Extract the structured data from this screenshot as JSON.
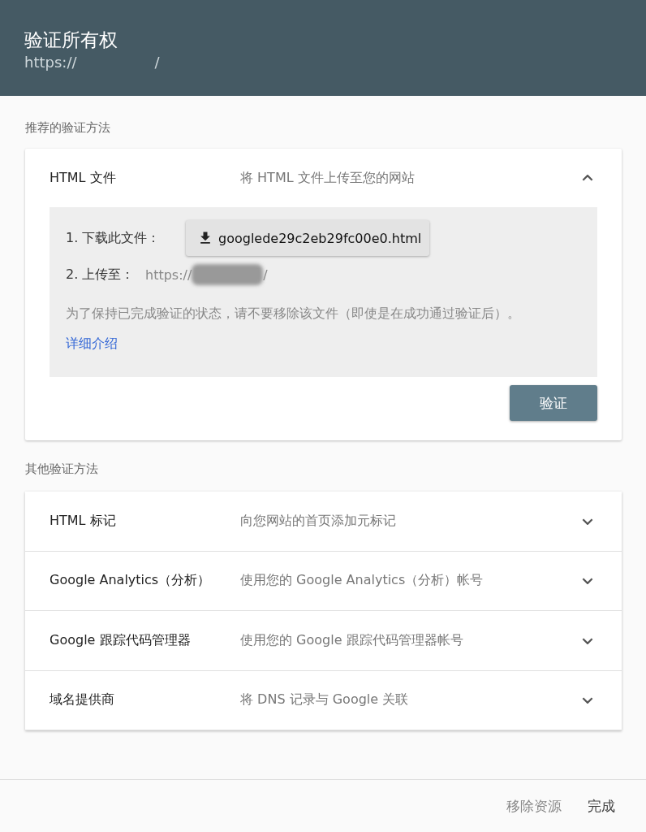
{
  "dialog": {
    "title": "验证所有权",
    "url_prefix": "https://",
    "url_suffix": "/"
  },
  "recommended": {
    "heading": "推荐的验证方法",
    "method": {
      "name": "HTML 文件",
      "description": "将 HTML 文件上传至您的网站",
      "expanded": true
    },
    "steps": {
      "download_label": "1. 下载此文件：",
      "download_file": "googlede29c2eb29fc00e0.html",
      "upload_label": "2. 上传至：",
      "upload_prefix": "https://",
      "upload_suffix": "/",
      "note": "为了保持已完成验证的状态，请不要移除该文件（即使是在成功通过验证后）。",
      "link": "详细介绍"
    },
    "verify_button": "验证"
  },
  "other": {
    "heading": "其他验证方法",
    "methods": [
      {
        "name": "HTML 标记",
        "description": "向您网站的首页添加元标记",
        "expanded": false
      },
      {
        "name": "Google Analytics（分析）",
        "description": "使用您的 Google Analytics（分析）帐号",
        "expanded": false
      },
      {
        "name": "Google 跟踪代码管理器",
        "description": "使用您的 Google 跟踪代码管理器帐号",
        "expanded": false
      },
      {
        "name": "域名提供商",
        "description": "将 DNS 记录与 Google 关联",
        "expanded": false
      }
    ]
  },
  "footer": {
    "buttons": [
      "移除资源",
      "完成"
    ]
  }
}
